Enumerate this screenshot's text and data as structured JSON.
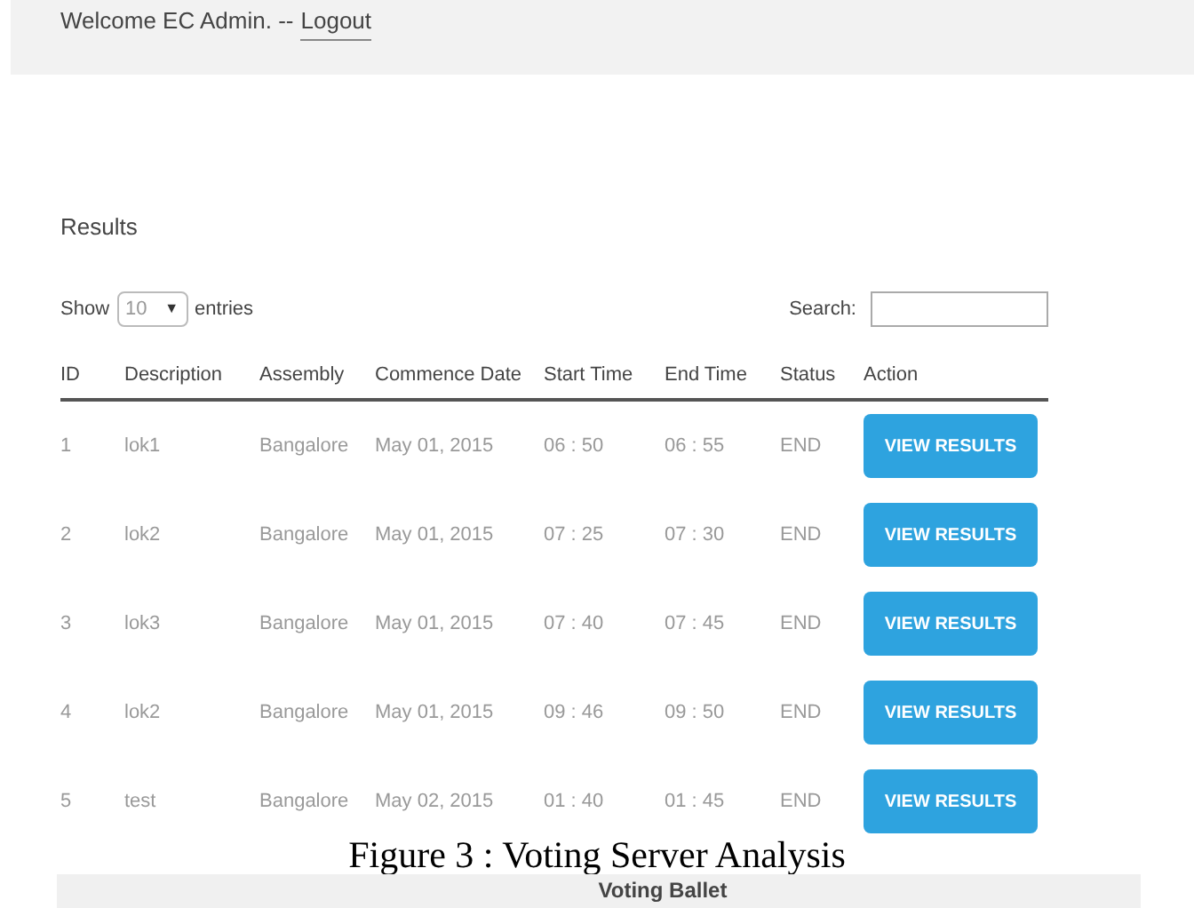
{
  "header": {
    "welcome": "Welcome EC Admin. --",
    "logout": "Logout"
  },
  "section_title": "Results",
  "length_control": {
    "show": "Show",
    "value": "10",
    "caret": "▼",
    "entries": "entries"
  },
  "search": {
    "label": "Search:"
  },
  "table": {
    "columns": [
      "ID",
      "Description",
      "Assembly",
      "Commence Date",
      "Start Time",
      "End Time",
      "Status",
      "Action"
    ],
    "rows": [
      {
        "id": "1",
        "description": "lok1",
        "assembly": "Bangalore",
        "date": "May 01, 2015",
        "start": "06 : 50",
        "end": "06 : 55",
        "status": "END",
        "action": "VIEW RESULTS"
      },
      {
        "id": "2",
        "description": "lok2",
        "assembly": "Bangalore",
        "date": "May 01, 2015",
        "start": "07 : 25",
        "end": "07 : 30",
        "status": "END",
        "action": "VIEW RESULTS"
      },
      {
        "id": "3",
        "description": "lok3",
        "assembly": "Bangalore",
        "date": "May 01, 2015",
        "start": "07 : 40",
        "end": "07 : 45",
        "status": "END",
        "action": "VIEW RESULTS"
      },
      {
        "id": "4",
        "description": "lok2",
        "assembly": "Bangalore",
        "date": "May 01, 2015",
        "start": "09 : 46",
        "end": "09 : 50",
        "status": "END",
        "action": "VIEW RESULTS"
      },
      {
        "id": "5",
        "description": "test",
        "assembly": "Bangalore",
        "date": "May 02, 2015",
        "start": "01 : 40",
        "end": "01 : 45",
        "status": "END",
        "action": "VIEW RESULTS"
      }
    ]
  },
  "caption": "Figure 3 : Voting Server Analysis",
  "next_panel": {
    "title": "Voting Ballet"
  }
}
